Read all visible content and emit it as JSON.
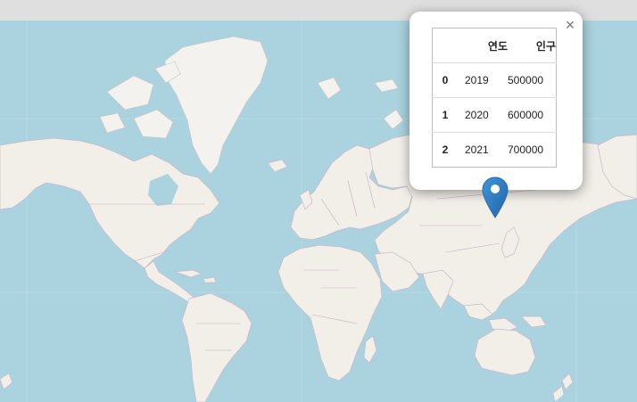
{
  "popup": {
    "close_label": "×",
    "table": {
      "columns": [
        "",
        "연도",
        "인구"
      ],
      "rows": [
        {
          "index": "0",
          "year": "2019",
          "population": "500000"
        },
        {
          "index": "1",
          "year": "2020",
          "population": "600000"
        },
        {
          "index": "2",
          "year": "2021",
          "population": "700000"
        }
      ]
    }
  },
  "marker": {
    "icon": "map-pin-icon",
    "color": "#2a81cb"
  },
  "colors": {
    "water": "#aad3df",
    "land": "#f2efe9",
    "border": "#c8a9c4"
  }
}
